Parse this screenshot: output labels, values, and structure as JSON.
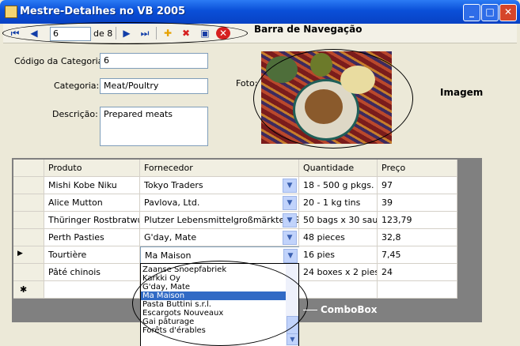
{
  "window": {
    "title": "Mestre-Detalhes no VB 2005",
    "minimize": "_",
    "maximize": "□",
    "close": "✕"
  },
  "toolbar": {
    "position": "6",
    "of_text": "de 8",
    "annotation": "Barra de Navegação"
  },
  "form": {
    "codigo_label": "Código da Categoria:",
    "codigo_value": "6",
    "categoria_label": "Categoria:",
    "categoria_value": "Meat/Poultry",
    "descricao_label": "Descrição:",
    "descricao_value": "Prepared meats",
    "foto_label": "Foto:"
  },
  "annotations": {
    "imagem": "Imagem",
    "combobox": "ComboBox"
  },
  "grid": {
    "headers": [
      "Produto",
      "Fornecedor",
      "Quantidade",
      "Preço"
    ],
    "rows": [
      [
        "Mishi Kobe Niku",
        "Tokyo Traders",
        "18 - 500 g pkgs.",
        "97"
      ],
      [
        "Alice Mutton",
        "Pavlova, Ltd.",
        "20 - 1 kg tins",
        "39"
      ],
      [
        "Thüringer Rostbratwu...",
        "Plutzer Lebensmittelgroßmärkte AG",
        "50 bags x 30 sau...",
        "123,79"
      ],
      [
        "Perth Pasties",
        "G'day, Mate",
        "48 pieces",
        "32,8"
      ],
      [
        "Tourtière",
        "Ma Maison",
        "16 pies",
        "7,45"
      ],
      [
        "Pâté chinois",
        "",
        "24 boxes x 2 pies",
        "24"
      ]
    ],
    "current_marker": "▶",
    "new_marker": "✱"
  },
  "dropdown": {
    "items": [
      "Zaanse Snoepfabriek",
      "Karkki Oy",
      "G'day, Mate",
      "Ma Maison",
      "Pasta Buttini s.r.l.",
      "Escargots Nouveaux",
      "Gai pâturage",
      "Forêts d'érables"
    ],
    "selected": "Ma Maison"
  },
  "colors": {
    "title_bar": "#0a4fd8",
    "selection": "#316ac5",
    "grid_bg": "#808080"
  }
}
